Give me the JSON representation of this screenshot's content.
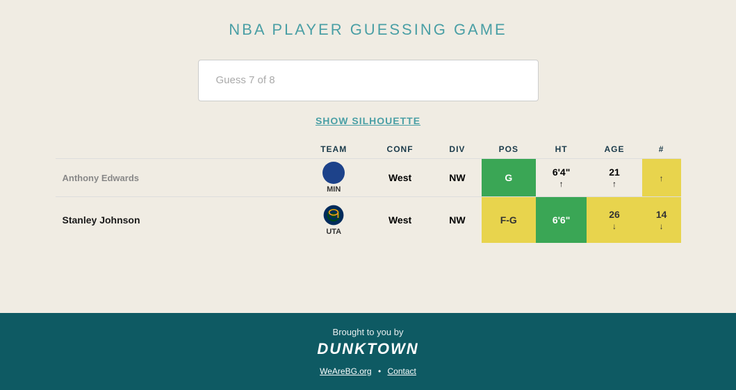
{
  "page": {
    "title": "NBA PLAYER GUESSING GAME"
  },
  "input": {
    "placeholder": "Guess 7 of 8"
  },
  "silhouette_btn": "SHOW SILHOUETTE",
  "table": {
    "headers": [
      "",
      "TEAM",
      "CONF",
      "DIV",
      "POS",
      "HT",
      "AGE",
      "#"
    ],
    "rows": [
      {
        "name": "Anthony Edwards",
        "team": "MIN",
        "conf": "West",
        "conf_color": "none",
        "div": "NW",
        "div_color": "none",
        "pos": "G",
        "pos_color": "green",
        "ht": "6'4\"",
        "ht_color": "none",
        "ht_arrow": "↑",
        "age": "21",
        "age_color": "none",
        "age_arrow": "↑",
        "number": "",
        "number_color": "yellow",
        "number_arrow": "↑"
      },
      {
        "name": "Stanley Johnson",
        "team": "UTA",
        "conf": "West",
        "conf_color": "none",
        "div": "NW",
        "div_color": "none",
        "pos": "F-G",
        "pos_color": "yellow",
        "ht": "6'6\"",
        "ht_color": "green",
        "ht_arrow": "",
        "age": "26",
        "age_color": "yellow",
        "age_arrow": "↓",
        "number": "14",
        "number_color": "yellow",
        "number_arrow": "↓"
      }
    ]
  },
  "footer": {
    "brought_label": "Brought to you by",
    "brand": "DUNKTOWN",
    "link1_label": "WeAreBG.org",
    "link1_url": "#",
    "separator": "•",
    "link2_label": "Contact",
    "link2_url": "#"
  }
}
